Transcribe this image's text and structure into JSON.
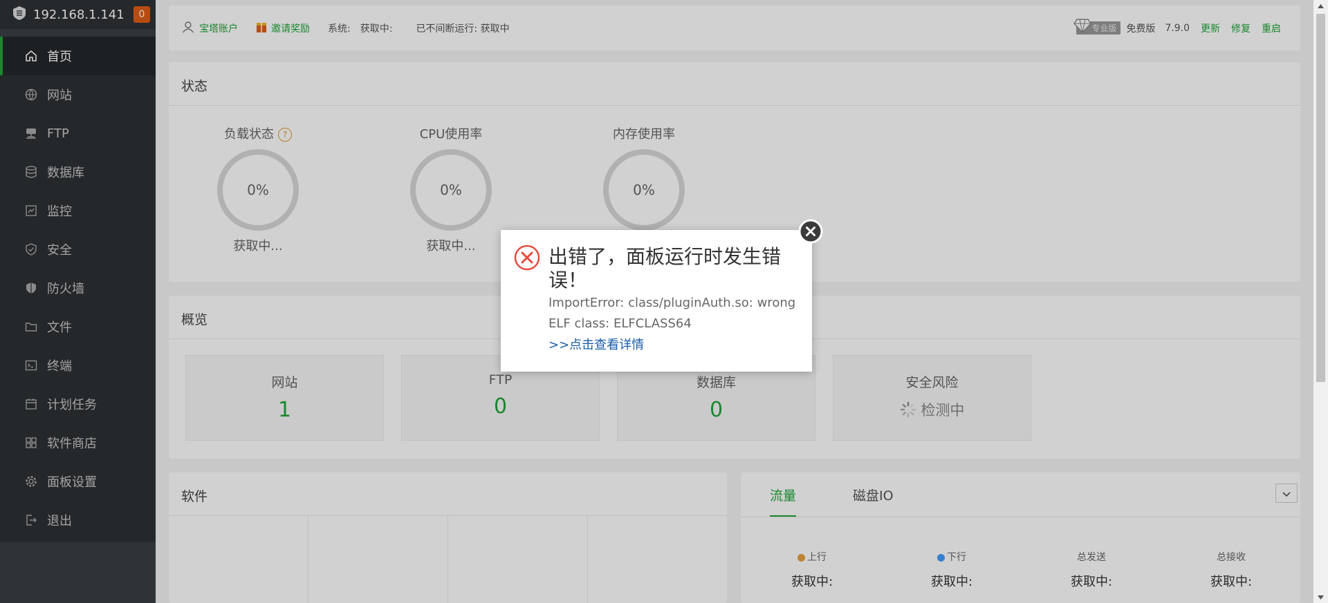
{
  "sidebar": {
    "host": "192.168.1.141",
    "badge": "0",
    "items": [
      {
        "label": "首页",
        "icon": "home-icon",
        "active": true
      },
      {
        "label": "网站",
        "icon": "globe-icon"
      },
      {
        "label": "FTP",
        "icon": "ftp-icon"
      },
      {
        "label": "数据库",
        "icon": "database-icon"
      },
      {
        "label": "监控",
        "icon": "monitor-icon"
      },
      {
        "label": "安全",
        "icon": "shield-check-icon"
      },
      {
        "label": "防火墙",
        "icon": "firewall-icon"
      },
      {
        "label": "文件",
        "icon": "folder-icon"
      },
      {
        "label": "终端",
        "icon": "terminal-icon"
      },
      {
        "label": "计划任务",
        "icon": "calendar-icon"
      },
      {
        "label": "软件商店",
        "icon": "apps-grid-icon"
      },
      {
        "label": "面板设置",
        "icon": "gear-icon"
      },
      {
        "label": "退出",
        "icon": "logout-icon"
      }
    ]
  },
  "topbar": {
    "account": "宝塔账户",
    "invite": "邀请奖励",
    "system_label": "系统:",
    "system_value": "获取中:",
    "uptime": "已不间断运行: 获取中",
    "pro_badge": "专业版",
    "edition": "免费版",
    "version": "7.9.0",
    "update": "更新",
    "repair": "修复",
    "restart": "重启"
  },
  "status": {
    "title": "状态",
    "gauges": [
      {
        "label": "负载状态",
        "value": "0%",
        "sub": "获取中..."
      },
      {
        "label": "CPU使用率",
        "value": "0%",
        "sub": "获取中..."
      },
      {
        "label": "内存使用率",
        "value": "0%",
        "sub": ""
      }
    ]
  },
  "overview": {
    "title": "概览",
    "boxes": [
      {
        "label": "网站",
        "value": "1"
      },
      {
        "label": "FTP",
        "value": "0"
      },
      {
        "label": "数据库",
        "value": "0"
      },
      {
        "label": "安全风险",
        "value": "检测中"
      }
    ]
  },
  "software": {
    "title": "软件"
  },
  "traffic": {
    "tabs": [
      "流量",
      "磁盘IO"
    ],
    "stats": [
      {
        "label": "上行",
        "value": "获取中:",
        "dot": "#e6a23c"
      },
      {
        "label": "下行",
        "value": "获取中:",
        "dot": "#409eff"
      },
      {
        "label": "总发送",
        "value": "获取中:"
      },
      {
        "label": "总接收",
        "value": "获取中:"
      }
    ]
  },
  "dialog": {
    "title": "出错了，面板运行时发生错误！",
    "message": "ImportError: class/pluginAuth.so: wrong ELF class: ELFCLASS64",
    "link": ">>点击查看详情"
  },
  "colors": {
    "accent": "#20a53a",
    "sidebar": "#2d3135",
    "error": "#e64b3c",
    "link": "#1a5ca8"
  }
}
